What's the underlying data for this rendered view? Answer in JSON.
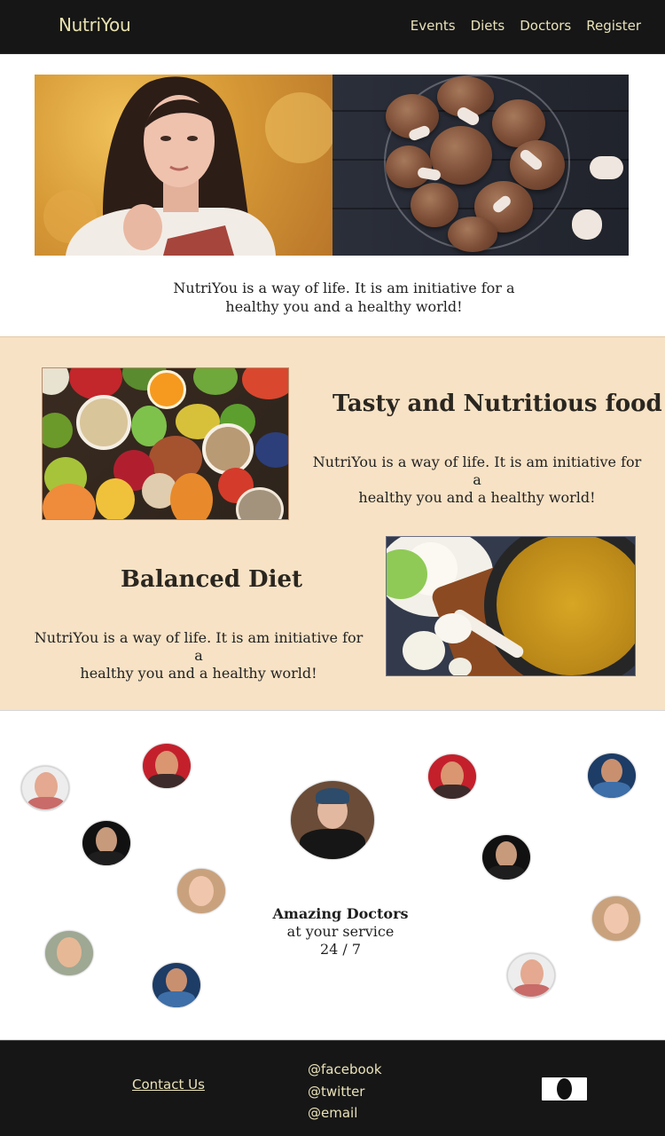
{
  "nav": {
    "brand": "NutriYou",
    "links": [
      "Events",
      "Diets",
      "Doctors",
      "Register"
    ]
  },
  "hero": {
    "caption_line1": "NutriYou is a way of life. It is am initiative for a",
    "caption_line2": "healthy you and a healthy world!"
  },
  "features": [
    {
      "title": "Tasty and Nutritious food",
      "text_line1": "NutriYou is a way of life. It is am initiative for a",
      "text_line2": "healthy you and a healthy world!"
    },
    {
      "title": "Balanced Diet",
      "text_line1": "NutriYou is a way of life. It is am initiative for a",
      "text_line2": "healthy you and a healthy world!"
    }
  ],
  "doctors": {
    "title": "Amazing Doctors",
    "subtitle": "at your service",
    "hours": "24 / 7"
  },
  "footer": {
    "contact": "Contact Us",
    "socials": [
      "@facebook",
      "@twitter",
      "@email"
    ]
  },
  "colors": {
    "nav_bg": "#161616",
    "nav_text": "#e9e2b8",
    "feature_bg": "#f7e2c5"
  }
}
